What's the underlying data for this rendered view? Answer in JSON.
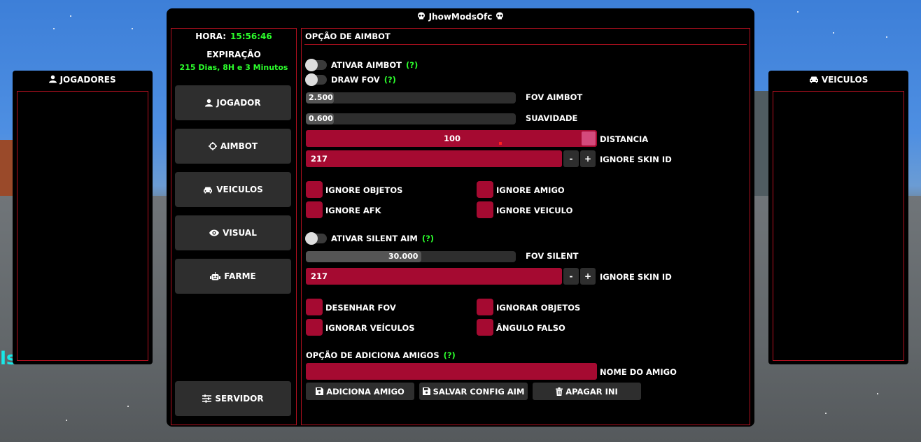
{
  "window": {
    "title": "JhowModsOfc"
  },
  "background": {
    "overlay_text": "ls"
  },
  "players_panel": {
    "title": "JOGADORES"
  },
  "vehicles_panel": {
    "title": "VEICULOS"
  },
  "info": {
    "hora_label": "HORA:",
    "hora_value": "15:56:46",
    "expiracao_label": "EXPIRAÇÃO",
    "expiracao_value": "215 Dias, 8H e 3 Minutos"
  },
  "nav": {
    "jogador": "JOGADOR",
    "aimbot": "AIMBOT",
    "veiculos": "VEICULOS",
    "visual": "VISUAL",
    "farme": "FARME",
    "servidor": "SERVIDOR"
  },
  "aimbot": {
    "section_title": "OPÇÃO DE AIMBOT",
    "help": "(?)",
    "ativar_aimbot": "ATIVAR AIMBOT",
    "draw_fov": "DRAW FOV",
    "fov_aimbot": {
      "label": "FOV AIMBOT",
      "value": "2.500"
    },
    "suavidade": {
      "label": "SUAVIDADE",
      "value": "0.600"
    },
    "distancia": {
      "label": "DISTANCIA",
      "value": "100"
    },
    "ignore_skin_1": {
      "label": "IGNORE SKIN ID",
      "value": "217",
      "minus": "-",
      "plus": "+"
    },
    "checks_1": [
      "IGNORE OBJETOS",
      "IGNORE AMIGO",
      "IGNORE AFK",
      "IGNORE VEICULO"
    ],
    "ativar_silent": "ATIVAR SILENT AIM",
    "fov_silent": {
      "label": "FOV SILENT",
      "value": "30.000"
    },
    "ignore_skin_2": {
      "label": "IGNORE SKIN ID",
      "value": "217",
      "minus": "-",
      "plus": "+"
    },
    "checks_2": [
      "DESENHAR FOV",
      "IGNORAR OBJETOS",
      "IGNORAR VEÍCULOS",
      "ÂNGULO FALSO"
    ],
    "amigos_title": "OPÇÃO DE ADICIONA AMIGOS",
    "nome_amigo": {
      "label": "NOME DO AMIGO",
      "value": ""
    },
    "buttons": {
      "adiciona": "ADICIONA AMIGO",
      "salvar": "SALVAR CONFIG AIM",
      "apagar": "APAGAR INI"
    }
  },
  "colors": {
    "accent": "#a50a31",
    "border": "#b3101f",
    "highlight": "#2cff2c"
  }
}
